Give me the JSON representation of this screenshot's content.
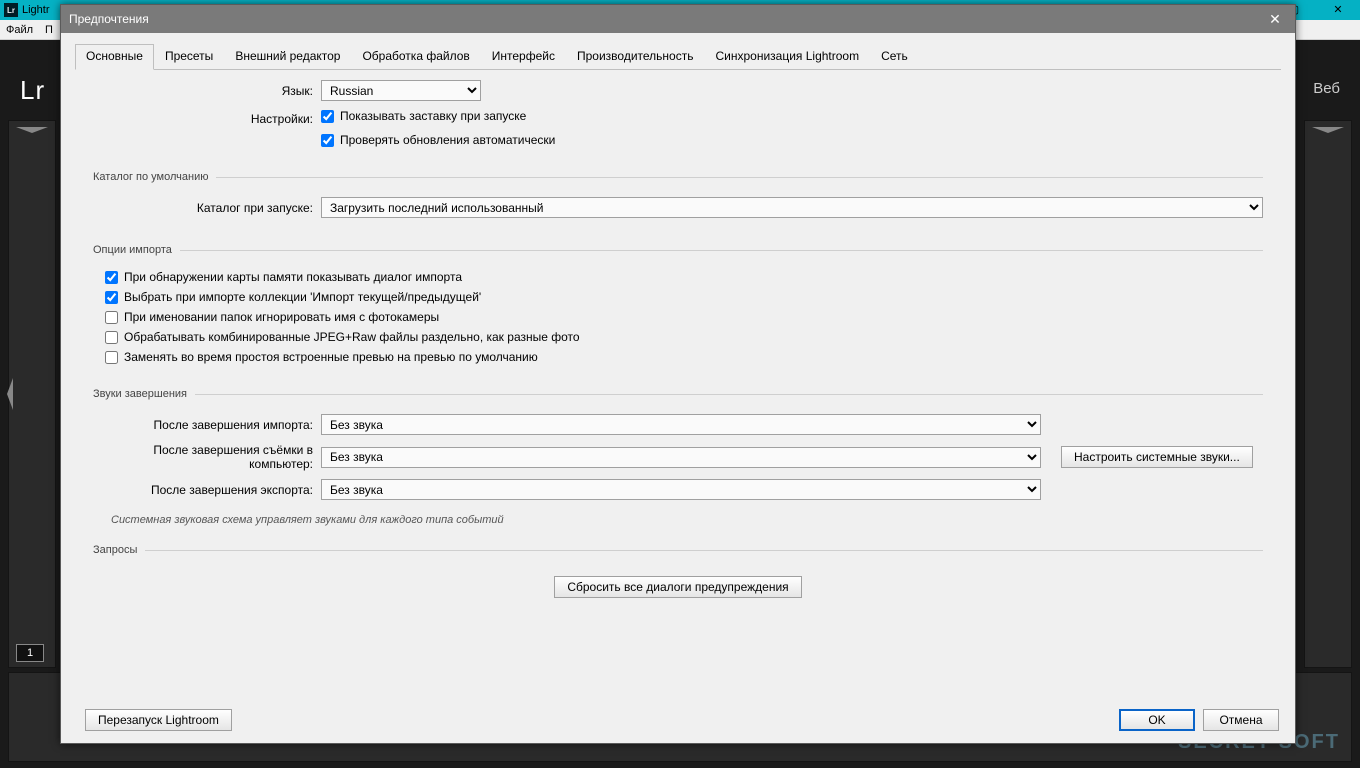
{
  "outer": {
    "title": "Lightr",
    "menu_file": "Файл",
    "menu_p": "П",
    "lr_right_nav": "Веб",
    "page_indicator": "1",
    "watermark": "SECRET-SOFT"
  },
  "dialog": {
    "title": "Предпочтения",
    "tabs": [
      "Основные",
      "Пресеты",
      "Внешний редактор",
      "Обработка файлов",
      "Интерфейс",
      "Производительность",
      "Синхронизация Lightroom",
      "Сеть"
    ],
    "active_tab_index": 0,
    "language_label": "Язык:",
    "language_value": "Russian",
    "settings_label": "Настройки:",
    "chk_splash": "Показывать заставку при запуске",
    "chk_updates": "Проверять обновления автоматически",
    "grp_default_catalog": "Каталог по умолчанию",
    "catalog_on_start_label": "Каталог при запуске:",
    "catalog_on_start_value": "Загрузить последний использованный",
    "grp_import": "Опции импорта",
    "chk_import_detect": "При обнаружении карты памяти показывать диалог импорта",
    "chk_import_collection": "Выбрать при импорте коллекции 'Импорт текущей/предыдущей'",
    "chk_import_ignore_camera_name": "При именовании папок игнорировать имя с фотокамеры",
    "chk_import_jpeg_raw": "Обрабатывать комбинированные JPEG+Raw файлы раздельно, как разные фото",
    "chk_import_replace_preview": "Заменять во время простоя встроенные превью на превью по умолчанию",
    "grp_sounds": "Звуки завершения",
    "after_import_label": "После завершения импорта:",
    "after_tether_label": "После завершения съёмки в компьютер:",
    "after_export_label": "После завершения экспорта:",
    "sound_none": "Без звука",
    "system_sounds_btn": "Настроить системные звуки...",
    "sounds_hint": "Системная звуковая схема управляет звуками для каждого типа событий",
    "grp_prompts": "Запросы",
    "reset_warnings_btn": "Сбросить все диалоги предупреждения",
    "restart_btn": "Перезапуск Lightroom",
    "ok_btn": "OK",
    "cancel_btn": "Отмена"
  }
}
